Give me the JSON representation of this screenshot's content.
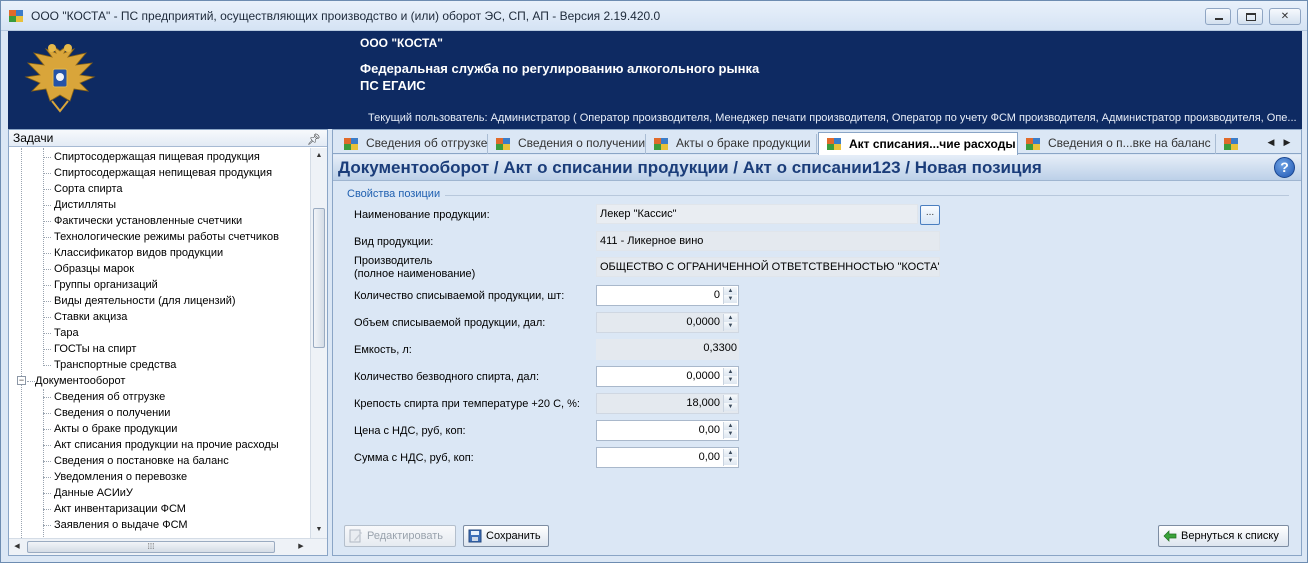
{
  "window": {
    "title": "ООО \"КОСТА\" - ПС предприятий, осуществляющих производство и (или) оборот ЭС, СП, АП - Версия 2.19.420.0"
  },
  "banner": {
    "org": "ООО \"КОСТА\"",
    "agency": "Федеральная служба по регулированию алкогольного рынка",
    "system": "ПС ЕГАИС",
    "current_user": "Текущий пользователь: Администратор ( Оператор производителя, Менеджер печати производителя, Оператор по учету ФСМ производителя, Администратор производителя, Опе..."
  },
  "tasks": {
    "title": "Задачи",
    "items": [
      {
        "label": "Спиртосодержащая пищевая продукция",
        "level": 2
      },
      {
        "label": "Спиртосодержащая непищевая продукция",
        "level": 2
      },
      {
        "label": "Сорта спирта",
        "level": 2
      },
      {
        "label": "Дистилляты",
        "level": 2
      },
      {
        "label": "Фактически установленные счетчики",
        "level": 2
      },
      {
        "label": "Технологические режимы работы счетчиков",
        "level": 2
      },
      {
        "label": "Классификатор видов продукции",
        "level": 2
      },
      {
        "label": "Образцы марок",
        "level": 2
      },
      {
        "label": "Группы организаций",
        "level": 2
      },
      {
        "label": "Виды деятельности (для лицензий)",
        "level": 2
      },
      {
        "label": "Ставки акциза",
        "level": 2
      },
      {
        "label": "Тара",
        "level": 2
      },
      {
        "label": "ГОСТы на спирт",
        "level": 2
      },
      {
        "label": "Транспортные средства",
        "level": 2
      },
      {
        "label": "Документооборот",
        "level": 1,
        "expander": "−"
      },
      {
        "label": "Сведения об отгрузке",
        "level": 2
      },
      {
        "label": "Сведения о получении",
        "level": 2
      },
      {
        "label": "Акты о браке продукции",
        "level": 2
      },
      {
        "label": "Акт списания продукции на прочие расходы",
        "level": 2
      },
      {
        "label": "Сведения о постановке на баланс",
        "level": 2
      },
      {
        "label": "Уведомления о перевозке",
        "level": 2
      },
      {
        "label": "Данные АСИиУ",
        "level": 2
      },
      {
        "label": "Акт инвентаризации ФСМ",
        "level": 2
      },
      {
        "label": "Заявления о выдаче ФСМ",
        "level": 2
      }
    ]
  },
  "tabs": [
    {
      "label": "Сведения об отгрузке",
      "active": false
    },
    {
      "label": "Сведения о получении",
      "active": false
    },
    {
      "label": "Акты о браке продукции",
      "active": false
    },
    {
      "label": "Акт списания...чие расходы",
      "active": true
    },
    {
      "label": "Сведения о п...вке на баланс",
      "active": false
    },
    {
      "label": "",
      "active": false
    }
  ],
  "doc": {
    "title": "Документооборот / Акт о списании продукции / Акт о списании123 / Новая позиция",
    "group": "Свойства позиции"
  },
  "fields": {
    "product_name_label": "Наименование продукции:",
    "product_name": "Лекер \"Кассис\"",
    "ellipsis": "...",
    "product_type_label": "Вид продукции:",
    "product_type": "411 - Ликерное вино",
    "producer_label_1": "Производитель",
    "producer_label_2": "(полное наименование)",
    "producer": "ОБЩЕСТВО С ОГРАНИЧЕННОЙ ОТВЕТСТВЕННОСТЬЮ \"КОСТА\"",
    "qty_label": "Количество списываемой продукции, шт:",
    "qty": "0",
    "volume_label": "Объем списываемой продукции, дал:",
    "volume": "0,0000",
    "capacity_label": "Емкость, л:",
    "capacity": "0,3300",
    "anhydrous_label": "Количество безводного спирта, дал:",
    "anhydrous": "0,0000",
    "strength_label": "Крепость спирта при температуре +20 С, %:",
    "strength": "18,000",
    "price_label": "Цена с НДС, руб, коп:",
    "price": "0,00",
    "sum_label": "Сумма с НДС, руб, коп:",
    "sum": "0,00"
  },
  "buttons": {
    "edit": "Редактировать",
    "save": "Сохранить",
    "back": "Вернуться к списку"
  },
  "colors": {
    "banner_bg": "#0e2a62",
    "title_blue": "#1b3d7a",
    "accent": "#2060b0"
  }
}
